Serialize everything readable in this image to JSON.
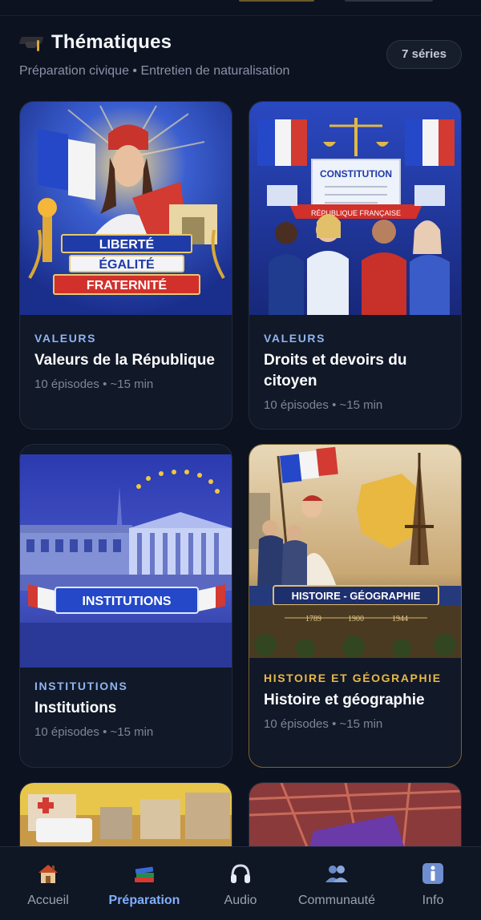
{
  "section": {
    "title": "Thématiques",
    "subtitle": "Préparation civique • Entretien de naturalisation",
    "count": "7 séries",
    "icon": "graduation-cap-icon"
  },
  "cards": [
    {
      "category": "VALEURS",
      "title": "Valeurs de la République",
      "meta": "10 épisodes • ~15 min",
      "art_text": [
        "LIBERTÉ",
        "ÉGALITÉ",
        "FRATERNITÉ"
      ]
    },
    {
      "category": "VALEURS",
      "title": "Droits et devoirs du citoyen",
      "meta": "10 épisodes • ~15 min",
      "art_text": [
        "CONSTITUTION",
        "RÉPUBLIQUE FRANÇAISE"
      ]
    },
    {
      "category": "INSTITUTIONS",
      "title": "Institutions",
      "meta": "10 épisodes • ~15 min",
      "art_text": [
        "INSTITUTIONS"
      ]
    },
    {
      "category": "HISTOIRE ET GÉOGRAPHIE",
      "title": "Histoire et géographie",
      "meta": "10 épisodes • ~15 min",
      "art_text": [
        "HISTOIRE - GÉOGRAPHIE",
        "1789",
        "1900",
        "1944"
      ]
    }
  ],
  "colors": {
    "background": "#0c1220",
    "card": "#111827",
    "accent_blue": "#7fb0ff",
    "accent_gold": "#e8b84a"
  },
  "nav": [
    {
      "label": "Accueil",
      "icon": "house-icon",
      "active": false
    },
    {
      "label": "Préparation",
      "icon": "books-icon",
      "active": true
    },
    {
      "label": "Audio",
      "icon": "headphones-icon",
      "active": false
    },
    {
      "label": "Communauté",
      "icon": "people-icon",
      "active": false
    },
    {
      "label": "Info",
      "icon": "info-icon",
      "active": false
    }
  ]
}
